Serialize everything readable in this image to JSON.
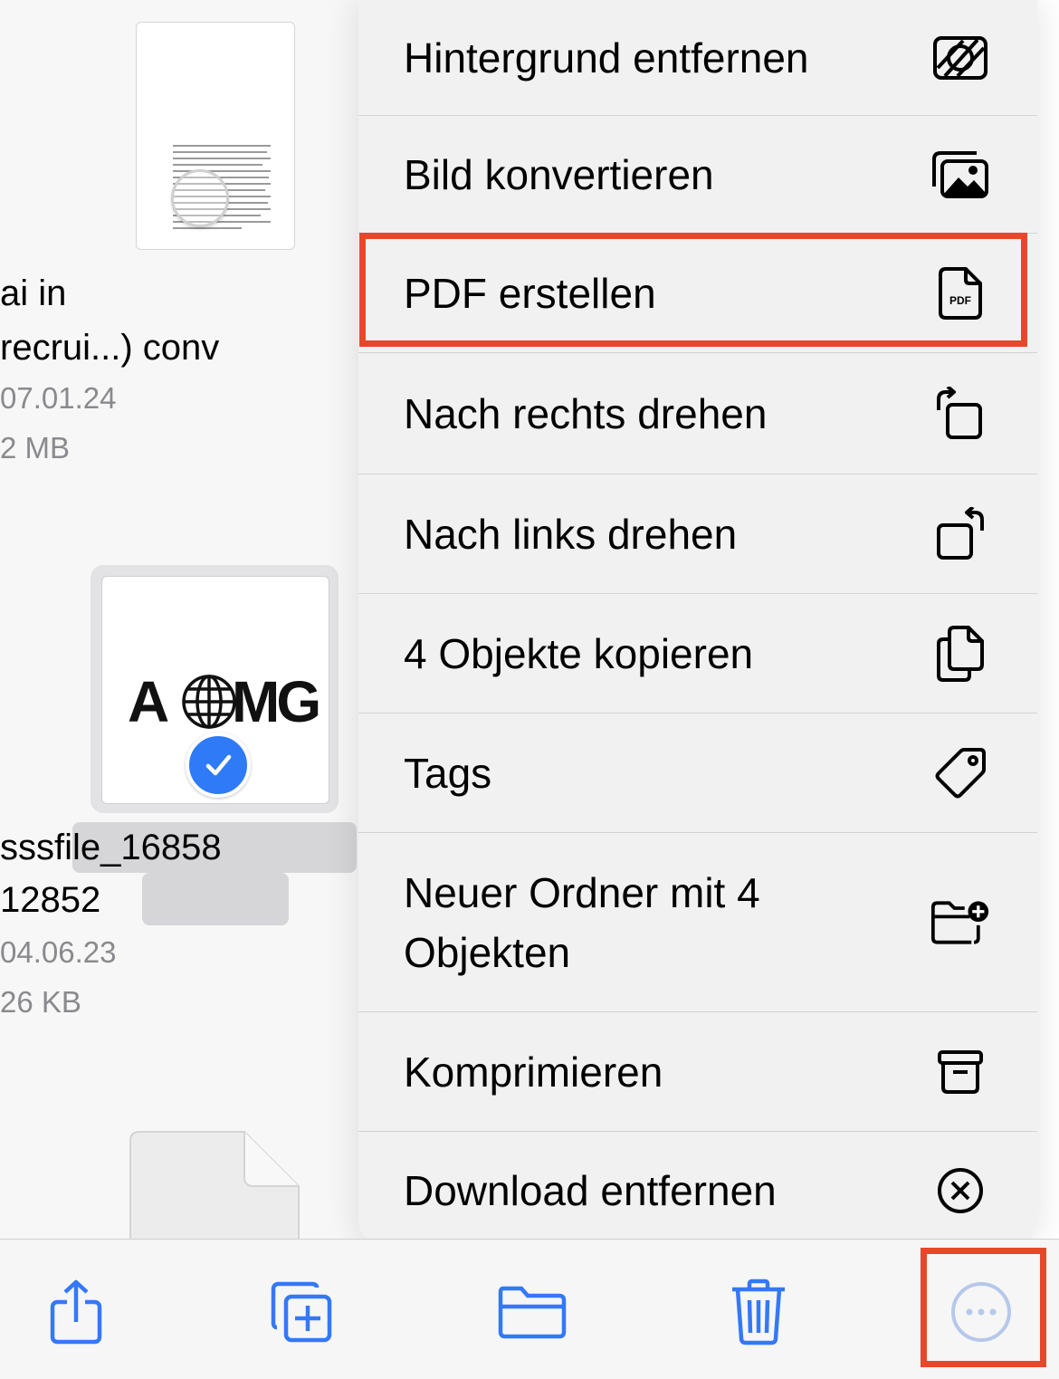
{
  "files": [
    {
      "name_line1": "ai in",
      "name_line2": "recrui...) conv",
      "date": "07.01.24",
      "size": "2 MB"
    },
    {
      "logo": "AGMG",
      "name_line1": "sssfile_16858",
      "name_line2": "12852",
      "date": "04.06.23",
      "size": "26 KB",
      "selected": true
    }
  ],
  "menu": {
    "items": [
      {
        "label": "Hintergrund entfernen",
        "icon": "remove-background-icon"
      },
      {
        "label": "Bild konvertieren",
        "icon": "photos-icon"
      },
      {
        "label": "PDF erstellen",
        "icon": "pdf-document-icon",
        "highlighted": true
      },
      {
        "label": "Nach rechts drehen",
        "icon": "rotate-right-icon"
      },
      {
        "label": "Nach links drehen",
        "icon": "rotate-left-icon"
      },
      {
        "label": "4 Objekte kopieren",
        "icon": "copy-documents-icon"
      },
      {
        "label": "Tags",
        "icon": "tag-icon"
      },
      {
        "label": "Neuer Ordner mit 4 Objekten",
        "icon": "folder-badge-plus-icon"
      },
      {
        "label": "Komprimieren",
        "icon": "archive-box-icon"
      },
      {
        "label": "Download entfernen",
        "icon": "xmark-circle-icon"
      }
    ],
    "pdf_badge": "PDF"
  },
  "toolbar": {
    "buttons": [
      "share-icon",
      "duplicate-icon",
      "folder-icon",
      "trash-icon",
      "more-icon"
    ],
    "accent_color": "#3478f6",
    "highlight_color": "#e8472b"
  }
}
